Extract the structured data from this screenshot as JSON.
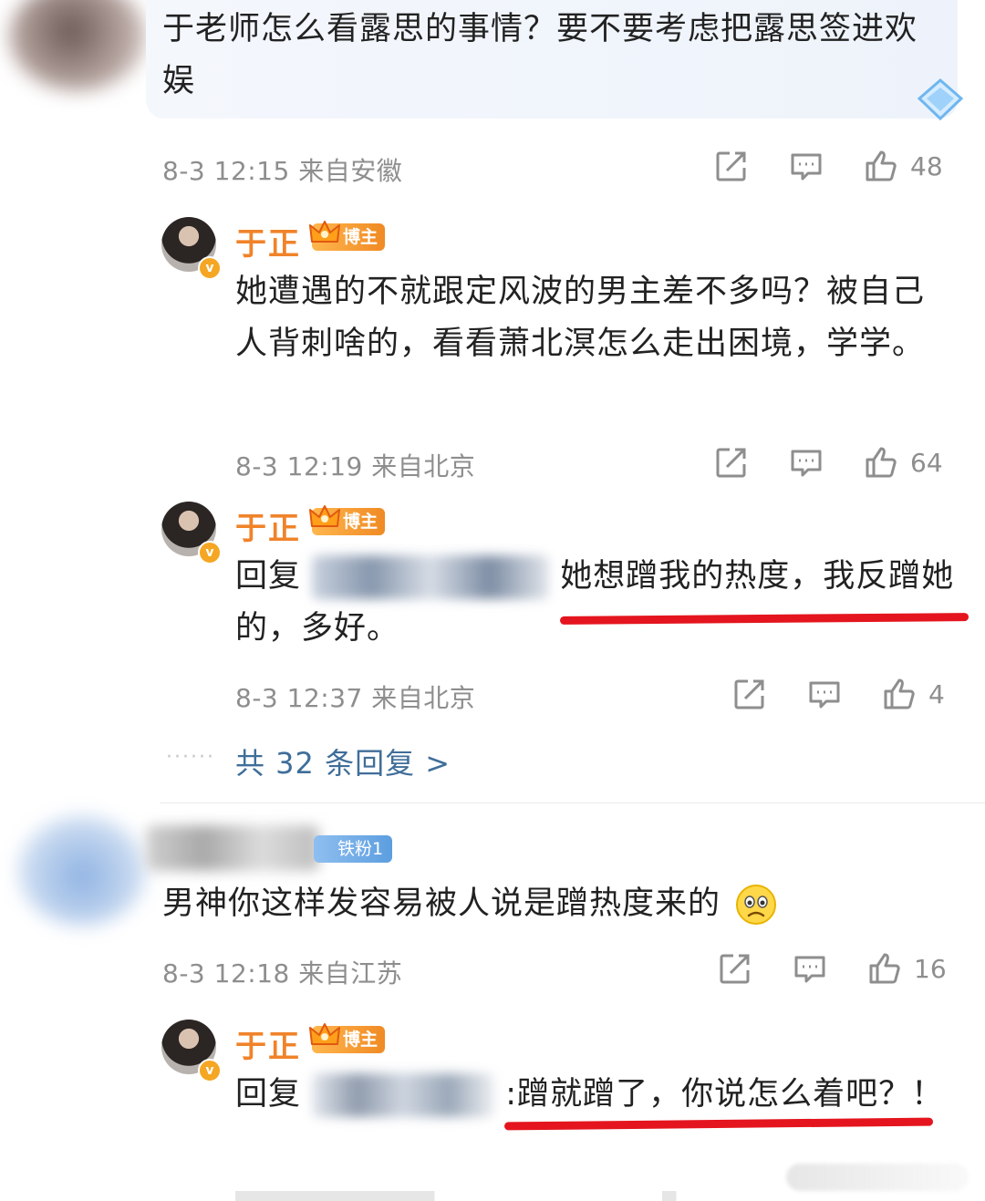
{
  "comments": [
    {
      "text": "于老师怎么看露思的事情？要不要考虑把露思签进欢娱",
      "meta": "8-3 12:15 来自安徽",
      "likes": "48"
    },
    {
      "text": "男神你这样发容易被人说是蹭热度来的",
      "meta": "8-3 12:18 来自江苏",
      "likes": "16",
      "badge": "铁粉1",
      "emoji": "sad-face"
    }
  ],
  "replies": [
    {
      "name": "于正",
      "badge": "博主",
      "text": "她遭遇的不就跟定风波的男主差不多吗？被自己人背刺啥的，看看萧北溟怎么走出困境，学学。",
      "meta": "8-3 12:19 来自北京",
      "likes": "64"
    },
    {
      "name": "于正",
      "badge": "博主",
      "prefix": "回复",
      "text": "她想蹭我的热度，我反蹭她的，多好。",
      "meta": "8-3 12:37 来自北京",
      "likes": "4"
    },
    {
      "name": "于正",
      "badge": "博主",
      "prefix": "回复",
      "text": ":蹭就蹭了，你说怎么着吧？！"
    }
  ],
  "more_replies": "共 32 条回复 >",
  "dots": "······",
  "colors": {
    "name": "#f0832a",
    "link": "#3f6e99",
    "meta": "#8e8e8e",
    "underline": "#e4151e"
  },
  "icons": [
    "share-icon",
    "comment-icon",
    "like-icon",
    "crown-icon",
    "verified-icon",
    "sad-emoji-icon"
  ]
}
